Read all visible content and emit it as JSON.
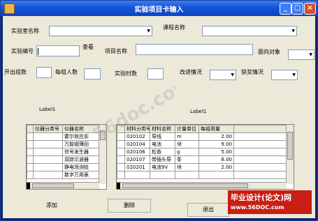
{
  "window": {
    "title": "实验项目卡输入"
  },
  "form": {
    "lab_name_label": "实验室名称",
    "course_name_label": "课程名称",
    "exp_no_label": "实验编号",
    "exp_no_value": "",
    "view_label": "查看",
    "project_name_label": "项目名称",
    "target_label": "面向对象",
    "groups_label": "开出组数",
    "per_group_label": "每组人数",
    "hours_label": "实验时数",
    "improve_label": "改进情况",
    "award_label": "获奖情况"
  },
  "grid_labels": {
    "left": "Label1",
    "right": "Label1"
  },
  "instrument_grid": {
    "headers": [
      "仪器分类号",
      "仪器名称"
    ],
    "rows": [
      [
        "",
        "霍尔效应实"
      ],
      [
        "",
        "万能铟薄回"
      ],
      [
        "",
        "信号发生器"
      ],
      [
        "",
        "双踪示波器"
      ],
      [
        "",
        "静电场测绘"
      ],
      [
        "",
        "数字万用表"
      ]
    ]
  },
  "material_grid": {
    "headers": [
      "材料分类号",
      "材料名称",
      "计量单位",
      "每组用量"
    ],
    "rows": [
      [
        "020102",
        "导线",
        "m",
        "2.00"
      ],
      [
        "020104",
        "电池",
        "块",
        "9.00"
      ],
      [
        "020106",
        "松香",
        "g",
        "5.00"
      ],
      [
        "020107",
        "带插头导",
        "条",
        "8.00"
      ],
      [
        "020201",
        "电池9V",
        "块",
        "2.00"
      ],
      [
        "",
        "",
        "",
        ""
      ]
    ]
  },
  "buttons": {
    "add": "添加",
    "delete": "删除",
    "exit": "退出"
  },
  "watermark": {
    "text": "56doc.com"
  },
  "badge": {
    "line1": "毕业设计(论文)网",
    "line2": "www.56DOC.com"
  }
}
